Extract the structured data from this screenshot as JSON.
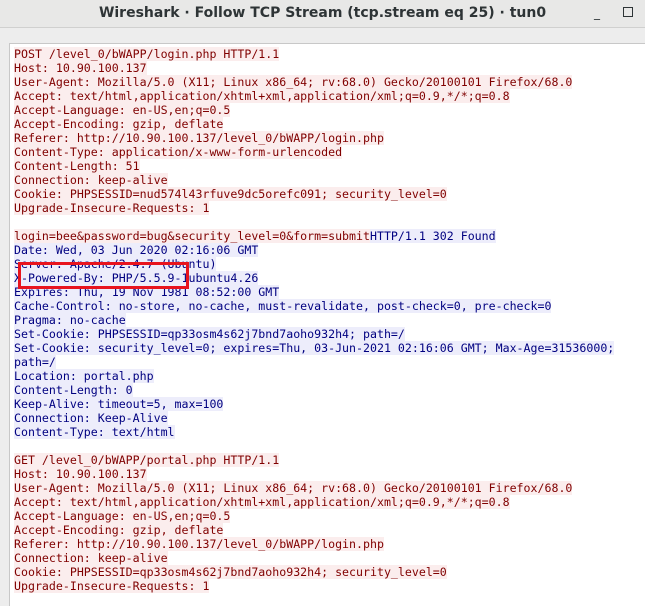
{
  "window": {
    "title": "Wireshark · Follow TCP Stream (tcp.stream eq 25) · tun0",
    "minimize_glyph": "_",
    "maximize_label": ""
  },
  "stream": {
    "request1": [
      "POST /level_0/bWAPP/login.php HTTP/1.1",
      "Host: 10.90.100.137",
      "User-Agent: Mozilla/5.0 (X11; Linux x86_64; rv:68.0) Gecko/20100101 Firefox/68.0",
      "Accept: text/html,application/xhtml+xml,application/xml;q=0.9,*/*;q=0.8",
      "Accept-Language: en-US,en;q=0.5",
      "Accept-Encoding: gzip, deflate",
      "Referer: http://10.90.100.137/level_0/bWAPP/login.php",
      "Content-Type: application/x-www-form-urlencoded",
      "Content-Length: 51",
      "Connection: keep-alive",
      "Cookie: PHPSESSID=nud574l43rfuve9dc5orefc091; security_level=0",
      "Upgrade-Insecure-Requests: 1"
    ],
    "request1_body": "login=bee&password=bug&security_level=0&form=submit",
    "response1_status": "HTTP/1.1 302 Found",
    "response1": [
      "Date: Wed, 03 Jun 2020 02:16:06 GMT",
      "Server: Apache/2.4.7 (Ubuntu)",
      "X-Powered-By: PHP/5.5.9-1ubuntu4.26",
      "Expires: Thu, 19 Nov 1981 08:52:00 GMT",
      "Cache-Control: no-store, no-cache, must-revalidate, post-check=0, pre-check=0",
      "Pragma: no-cache",
      "Set-Cookie: PHPSESSID=qp33osm4s62j7bnd7aoho932h4; path=/",
      "Set-Cookie: security_level=0; expires=Thu, 03-Jun-2021 02:16:06 GMT; Max-Age=31536000;",
      "path=/",
      "Location: portal.php",
      "Content-Length: 0",
      "Keep-Alive: timeout=5, max=100",
      "Connection: Keep-Alive",
      "Content-Type: text/html"
    ],
    "request2": [
      "GET /level_0/bWAPP/portal.php HTTP/1.1",
      "Host: 10.90.100.137",
      "User-Agent: Mozilla/5.0 (X11; Linux x86_64; rv:68.0) Gecko/20100101 Firefox/68.0",
      "Accept: text/html,application/xhtml+xml,application/xml;q=0.9,*/*;q=0.8",
      "Accept-Language: en-US,en;q=0.5",
      "Accept-Encoding: gzip, deflate",
      "Referer: http://10.90.100.137/level_0/bWAPP/login.php",
      "Connection: keep-alive",
      "Cookie: PHPSESSID=qp33osm4s62j7bnd7aoho932h4; security_level=0",
      "Upgrade-Insecure-Requests: 1"
    ]
  },
  "colors": {
    "client_text": "#800000",
    "client_bg": "#fbeded",
    "server_text": "#000080",
    "server_bg": "#ededfb",
    "annotation_box": "#e8141e"
  }
}
